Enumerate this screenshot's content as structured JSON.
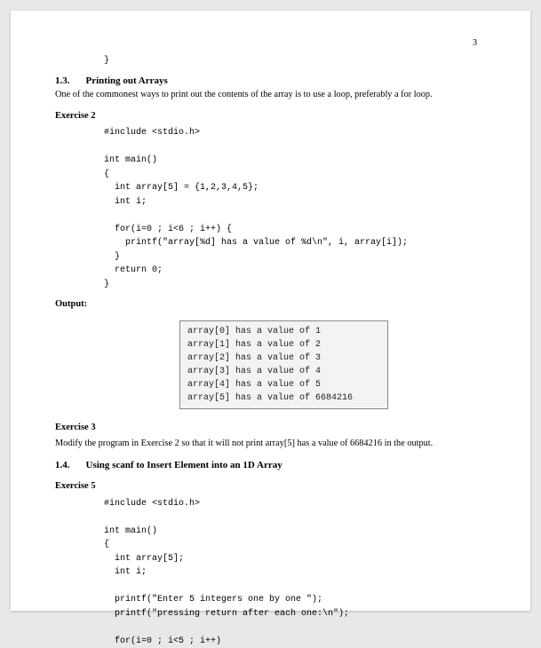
{
  "page_number": "3",
  "leading_brace": "}",
  "section_1_3": {
    "number": "1.3.",
    "title": "Printing out Arrays",
    "body": "One of the commonest ways to print out the contents of the array is to use a loop, preferably a for loop."
  },
  "exercise2": {
    "label": "Exercise 2",
    "code": "#include <stdio.h>\n\nint main()\n{\n  int array[5] = {1,2,3,4,5};\n  int i;\n\n  for(i=0 ; i<6 ; i++) {\n    printf(\"array[%d] has a value of %d\\n\", i, array[i]);\n  }\n  return 0;\n}"
  },
  "output": {
    "label": "Output:",
    "text": "array[0] has a value of 1\narray[1] has a value of 2\narray[2] has a value of 3\narray[3] has a value of 4\narray[4] has a value of 5\narray[5] has a value of 6684216"
  },
  "exercise3": {
    "label": "Exercise 3",
    "body": "Modify the program in Exercise 2 so that it will not print array[5] has a value of 6684216 in the output."
  },
  "section_1_4": {
    "number": "1.4.",
    "title": "Using scanf to Insert Element into an 1D Array"
  },
  "exercise5": {
    "label": "Exercise 5",
    "code": "#include <stdio.h>\n\nint main()\n{\n  int array[5];\n  int i;\n\n  printf(\"Enter 5 integers one by one \");\n  printf(\"pressing return after each one:\\n\");\n\n  for(i=0 ; i<5 ; i++)"
  }
}
